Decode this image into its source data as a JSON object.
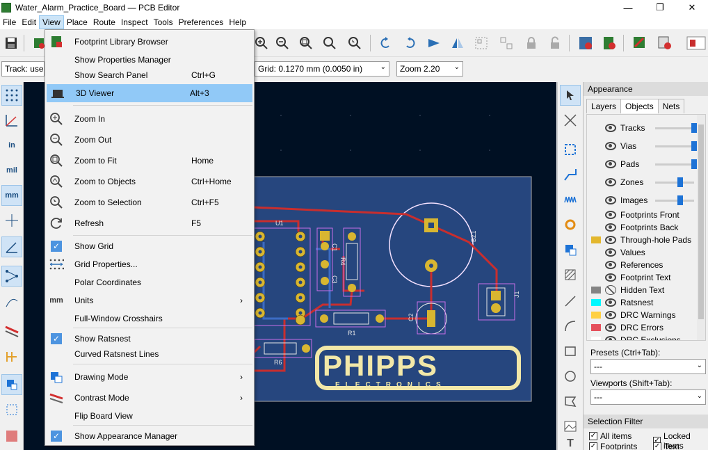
{
  "window": {
    "title": "Water_Alarm_Practice_Board — PCB Editor",
    "controls": [
      "—",
      "❐",
      "✕"
    ]
  },
  "menubar": [
    "File",
    "Edit",
    "View",
    "Place",
    "Route",
    "Inspect",
    "Tools",
    "Preferences",
    "Help"
  ],
  "toolbar2": {
    "track": "Track: use n",
    "grid": "Grid: 0.1270 mm (0.0050 in)",
    "zoom": "Zoom 2.20"
  },
  "left_toolbar": [
    "in",
    "mil",
    "mm"
  ],
  "view_menu": {
    "items": [
      {
        "label": "Footprint Library Browser",
        "shortcut": "",
        "icon": "footprint-library-icon"
      },
      {
        "label": "Show Properties Manager",
        "shortcut": "",
        "icon": ""
      },
      {
        "label": "Show Search Panel",
        "shortcut": "Ctrl+G",
        "icon": ""
      },
      {
        "label": "3D Viewer",
        "shortcut": "Alt+3",
        "icon": "3d-viewer-icon"
      },
      {
        "label": "Zoom In",
        "shortcut": "",
        "icon": "zoom-in-icon"
      },
      {
        "label": "Zoom Out",
        "shortcut": "",
        "icon": "zoom-out-icon"
      },
      {
        "label": "Zoom to Fit",
        "shortcut": "Home",
        "icon": "zoom-fit-icon"
      },
      {
        "label": "Zoom to Objects",
        "shortcut": "Ctrl+Home",
        "icon": "zoom-objects-icon"
      },
      {
        "label": "Zoom to Selection",
        "shortcut": "Ctrl+F5",
        "icon": "zoom-selection-icon"
      },
      {
        "label": "Refresh",
        "shortcut": "F5",
        "icon": "refresh-icon"
      },
      {
        "label": "Show Grid",
        "shortcut": "",
        "icon": "check-icon"
      },
      {
        "label": "Grid Properties...",
        "shortcut": "",
        "icon": "grid-properties-icon"
      },
      {
        "label": "Polar Coordinates",
        "shortcut": "",
        "icon": ""
      },
      {
        "label": "Units",
        "shortcut": "",
        "icon": "units-icon"
      },
      {
        "label": "Full-Window Crosshairs",
        "shortcut": "",
        "icon": ""
      },
      {
        "label": "Show Ratsnest",
        "shortcut": "",
        "icon": "check-icon"
      },
      {
        "label": "Curved Ratsnest Lines",
        "shortcut": "",
        "icon": ""
      },
      {
        "label": "Drawing Mode",
        "shortcut": "",
        "icon": "drawing-mode-icon"
      },
      {
        "label": "Contrast Mode",
        "shortcut": "",
        "icon": "contrast-mode-icon"
      },
      {
        "label": "Flip Board View",
        "shortcut": "",
        "icon": ""
      },
      {
        "label": "Show Appearance Manager",
        "shortcut": "",
        "icon": "check-icon"
      }
    ]
  },
  "appearance": {
    "header": "Appearance",
    "tabs": [
      "Layers",
      "Objects",
      "Nets"
    ],
    "objects": [
      {
        "label": "Tracks",
        "visible": true,
        "opacity": 1.0
      },
      {
        "label": "Vias",
        "visible": true,
        "opacity": 1.0
      },
      {
        "label": "Pads",
        "visible": true,
        "opacity": 1.0
      },
      {
        "label": "Zones",
        "visible": true,
        "opacity": 0.6
      },
      {
        "label": "Images",
        "visible": true,
        "opacity": 0.6
      },
      {
        "label": "Footprints Front",
        "visible": true
      },
      {
        "label": "Footprints Back",
        "visible": true
      },
      {
        "label": "Through-hole Pads",
        "visible": true,
        "color": "#e3b72d"
      },
      {
        "label": "Values",
        "visible": true
      },
      {
        "label": "References",
        "visible": true
      },
      {
        "label": "Footprint Text",
        "visible": true
      },
      {
        "label": "Hidden Text",
        "visible": false,
        "color": "#848484"
      },
      {
        "label": "Ratsnest",
        "visible": true,
        "color": "#00f8ff"
      },
      {
        "label": "DRC Warnings",
        "visible": true,
        "color": "#ffd042"
      },
      {
        "label": "DRC Errors",
        "visible": true,
        "color": "#e5505b"
      },
      {
        "label": "DRC Exclusions",
        "visible": true,
        "color": "#ffffff"
      }
    ],
    "presets_label": "Presets (Ctrl+Tab):",
    "presets_value": "---",
    "viewports_label": "Viewports (Shift+Tab):",
    "viewports_value": "---",
    "selection_filter": "Selection Filter",
    "filters": [
      {
        "label": "All items",
        "checked": true
      },
      {
        "label": "Locked items",
        "checked": true
      },
      {
        "label": "Footprints",
        "checked": true
      },
      {
        "label": "Text",
        "checked": true
      }
    ]
  },
  "board": {
    "labels": [
      "U1",
      "C1",
      "R4",
      "C3",
      "C2",
      "BZ1",
      "J1",
      "R1",
      "R6"
    ],
    "logo_main": "PHIPPS",
    "logo_sub": "ELECTRONICS"
  }
}
